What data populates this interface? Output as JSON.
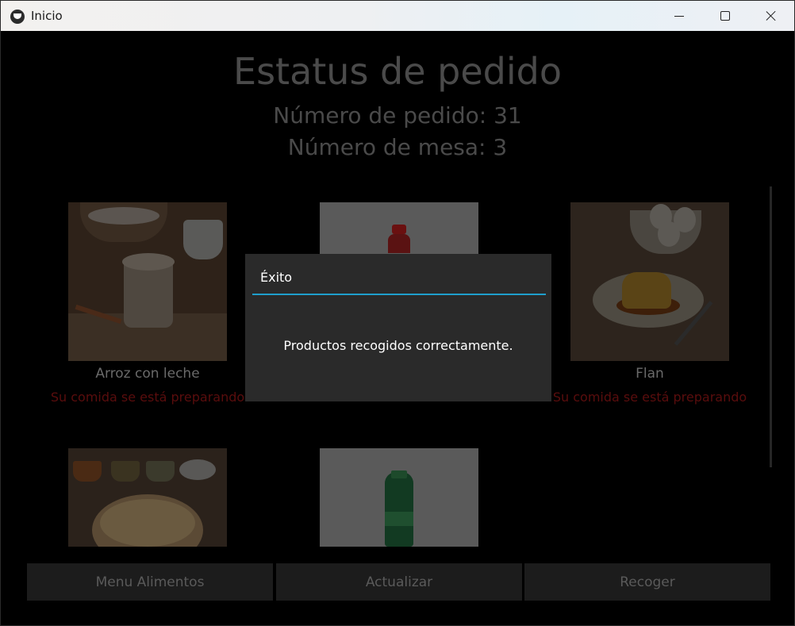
{
  "window": {
    "title": "Inicio"
  },
  "header": {
    "title": "Estatus de pedido",
    "order_number": "Número de pedido: 31",
    "table_number": "Número de mesa: 3"
  },
  "items": [
    {
      "name": "Arroz con leche",
      "status": "Su comida se está preparando"
    },
    {
      "name": "",
      "status": ""
    },
    {
      "name": "Flan",
      "status": "Su comida se está preparando"
    }
  ],
  "buttons": {
    "menu": "Menu Alimentos",
    "refresh": "Actualizar",
    "pickup": "Recoger"
  },
  "dialog": {
    "title": "Éxito",
    "message": "Productos recogidos correctamente."
  },
  "colors": {
    "dialog_accent": "#1f9fcc",
    "status_text": "#cc1a1a"
  }
}
